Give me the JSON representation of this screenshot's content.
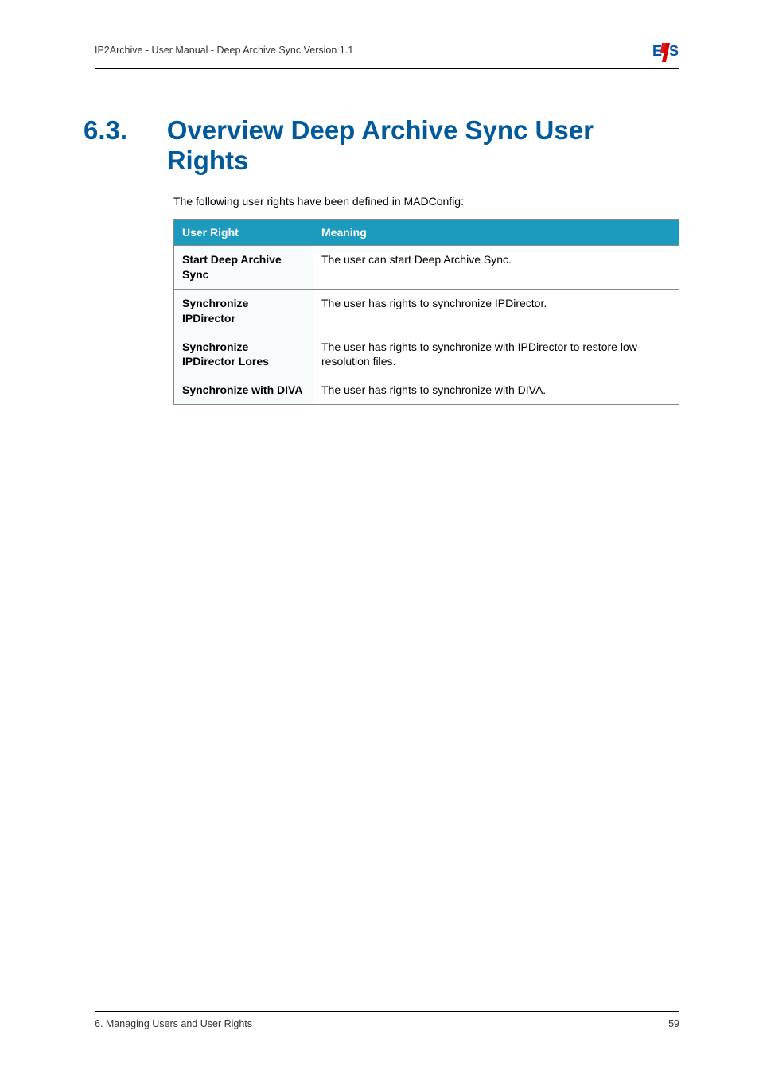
{
  "header": {
    "text": "IP2Archive - User Manual - Deep Archive Sync Version 1.1",
    "logo_alt": "EVS"
  },
  "section": {
    "number": "6.3.",
    "title": "Overview Deep Archive Sync User Rights"
  },
  "intro": "The following user rights have been defined in MADConfig:",
  "table": {
    "head": {
      "c1": "User Right",
      "c2": "Meaning"
    },
    "rows": [
      {
        "c1": "Start Deep Archive Sync",
        "c2": "The user can start Deep Archive Sync."
      },
      {
        "c1": "Synchronize IPDirector",
        "c2": "The user has rights to synchronize IPDirector."
      },
      {
        "c1": "Synchronize IPDirector Lores",
        "c2": "The user has rights to synchronize with IPDirector to restore low-resolution files."
      },
      {
        "c1": "Synchronize with DIVA",
        "c2": "The user has rights to synchronize with DIVA."
      }
    ]
  },
  "footer": {
    "left": "6. Managing Users and User Rights",
    "right": "59"
  }
}
